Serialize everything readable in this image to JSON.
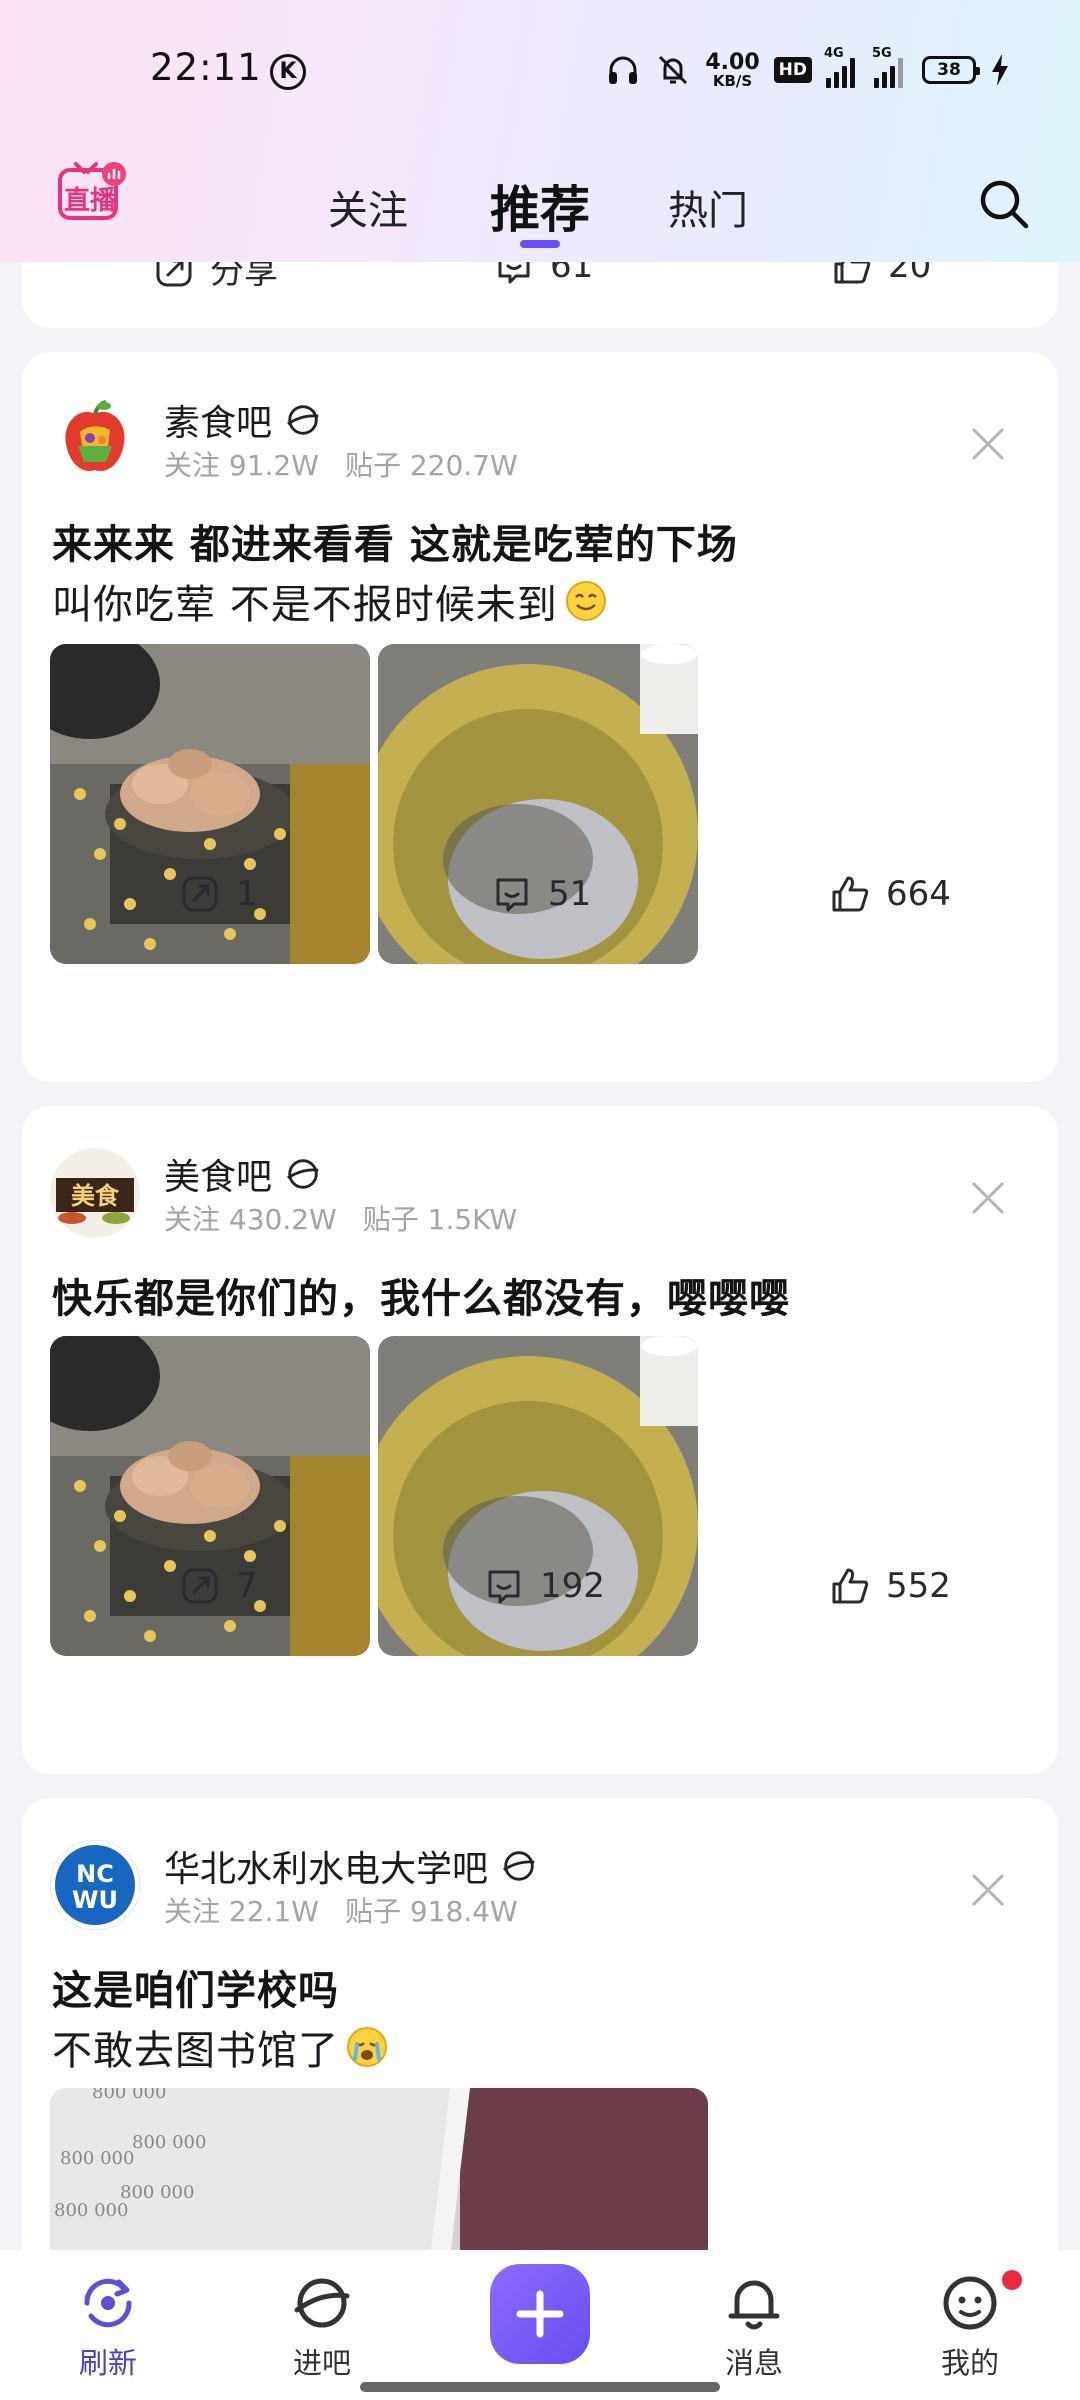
{
  "status_bar": {
    "time": "22:11",
    "net_speed_value": "4.00",
    "net_speed_unit": "KB/S",
    "hd_badge": "HD",
    "sig1_label": "4G",
    "sig2_label": "5G",
    "battery": "38"
  },
  "nav": {
    "live_label": "直播",
    "tabs": [
      {
        "label": "关注"
      },
      {
        "label": "推荐"
      },
      {
        "label": "热门"
      }
    ],
    "active_tab": "推荐"
  },
  "partial_card": {
    "share_label": "分享",
    "comments": "61",
    "likes": "20"
  },
  "posts": [
    {
      "forum": "素食吧",
      "followers": "关注 91.2W",
      "posts_count": "贴子 220.7W",
      "title": "来来来 都进来看看 这就是吃荤的下场",
      "body": "叫你吃荤 不是不报时候未到",
      "body_emoji": "smile-emoji",
      "shares": "1",
      "comments": "51",
      "likes": "664"
    },
    {
      "forum": "美食吧",
      "followers": "关注 430.2W",
      "posts_count": "贴子 1.5KW",
      "title": "快乐都是你们的，我什么都没有，嘤嘤嘤",
      "shares": "7",
      "comments": "192",
      "likes": "552"
    },
    {
      "forum": "华北水利水电大学吧",
      "followers": "关注 22.1W",
      "posts_count": "贴子 918.4W",
      "title": "这是咱们学校吗",
      "body": "不敢去图书馆了",
      "body_emoji": "crying-emoji",
      "avatar_text": "NCWU",
      "image_text": [
        "800 000",
        "800 000",
        "800 000",
        "800 000",
        "800 000"
      ]
    }
  ],
  "bottom_nav": {
    "items": [
      {
        "label": "刷新"
      },
      {
        "label": "进吧"
      },
      {
        "label": "消息"
      },
      {
        "label": "我的"
      }
    ]
  },
  "colors": {
    "accent": "#6b4cf5",
    "live_logo": "#e8337f",
    "meta_gray": "#a3a3a8"
  }
}
